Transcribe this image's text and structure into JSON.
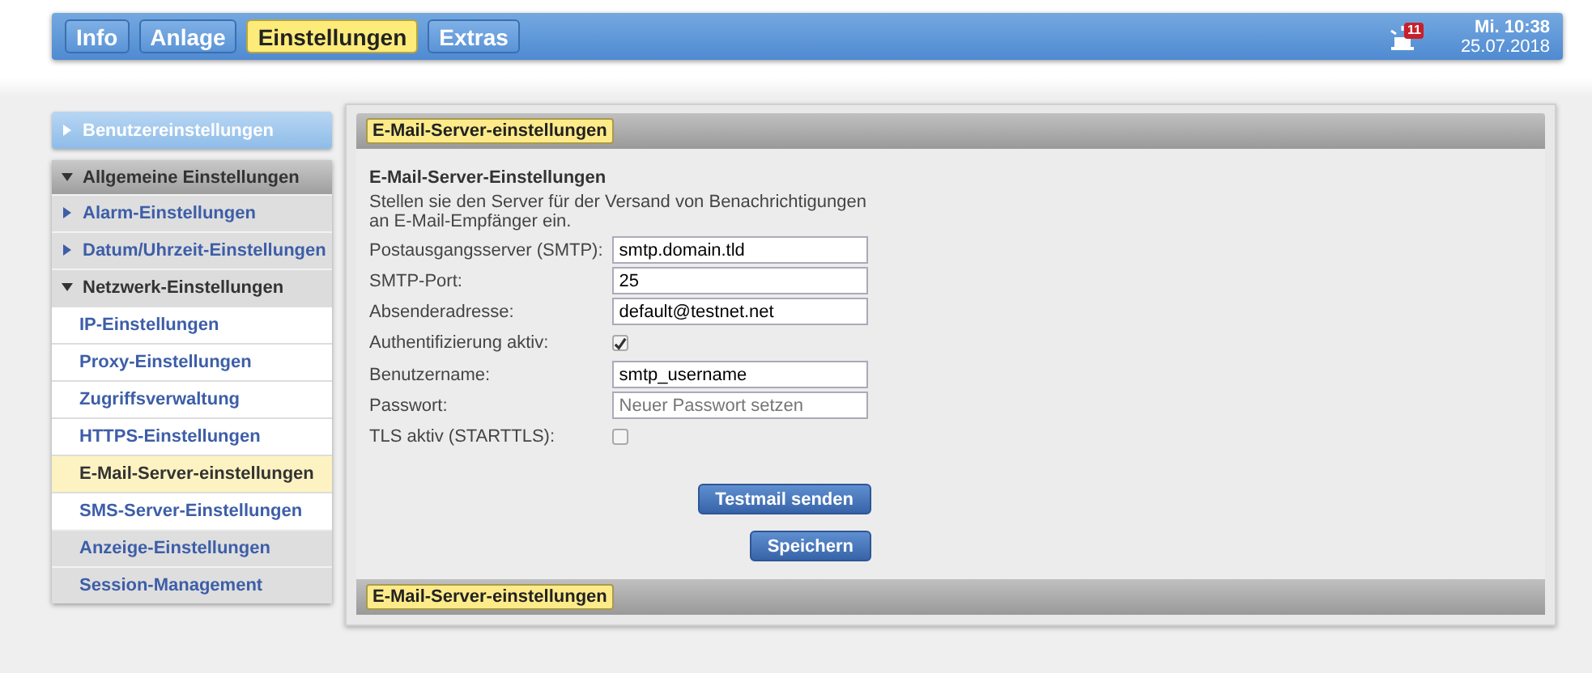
{
  "nav_tabs": [
    {
      "label": "Info",
      "selected": false
    },
    {
      "label": "Anlage",
      "selected": false
    },
    {
      "label": "Einstellungen",
      "selected": true
    },
    {
      "label": "Extras",
      "selected": false
    }
  ],
  "alarm_badge": "11",
  "clock": {
    "day_time": "Mi. 10:38",
    "date": "25.07.2018"
  },
  "sidebar": {
    "items": [
      {
        "label": "Benutzereinstellungen",
        "kind": "header",
        "expanded": false
      },
      {
        "label": "Allgemeine Einstellungen",
        "kind": "group",
        "expanded": true,
        "children": [
          {
            "label": "Alarm-Einstellungen",
            "kind": "folder",
            "expanded": false
          },
          {
            "label": "Datum/Uhrzeit-Einstellungen",
            "kind": "folder",
            "expanded": false
          },
          {
            "label": "Netzwerk-Einstellungen",
            "kind": "folder",
            "expanded": true,
            "children": [
              {
                "label": "IP-Einstellungen",
                "selected": false
              },
              {
                "label": "Proxy-Einstellungen",
                "selected": false
              },
              {
                "label": "Zugriffsverwaltung",
                "selected": false
              },
              {
                "label": "HTTPS-Einstellungen",
                "selected": false
              },
              {
                "label": "E-Mail-Server-einstellungen",
                "selected": true
              },
              {
                "label": "SMS-Server-Einstellungen",
                "selected": false
              }
            ]
          },
          {
            "label": "Anzeige-Einstellungen",
            "kind": "leaf"
          },
          {
            "label": "Session-Management",
            "kind": "leaf"
          }
        ]
      }
    ]
  },
  "panel": {
    "header_tag": "E-Mail-Server-einstellungen",
    "heading": "E-Mail-Server-Einstellungen",
    "description": "Stellen sie den Server für der Versand von Benachrichtigungen an E-Mail-Empfänger ein.",
    "fields": [
      {
        "label": "Postausgangsserver (SMTP):",
        "kind": "text",
        "value": "smtp.domain.tld"
      },
      {
        "label": "SMTP-Port:",
        "kind": "text",
        "value": "25"
      },
      {
        "label": "Absenderadresse:",
        "kind": "text",
        "value": "default@testnet.net"
      },
      {
        "label": "Authentifizierung aktiv:",
        "kind": "checkbox",
        "checked": true
      },
      {
        "label": "Benutzername:",
        "kind": "text",
        "value": "smtp_username"
      },
      {
        "label": "Passwort:",
        "kind": "text",
        "placeholder": "Neuer Passwort setzen"
      },
      {
        "label": "TLS aktiv (STARTTLS):",
        "kind": "checkbox",
        "checked": false
      }
    ],
    "buttons": [
      "Testmail senden",
      "Speichern"
    ],
    "footer_tag": "E-Mail-Server-einstellungen"
  }
}
